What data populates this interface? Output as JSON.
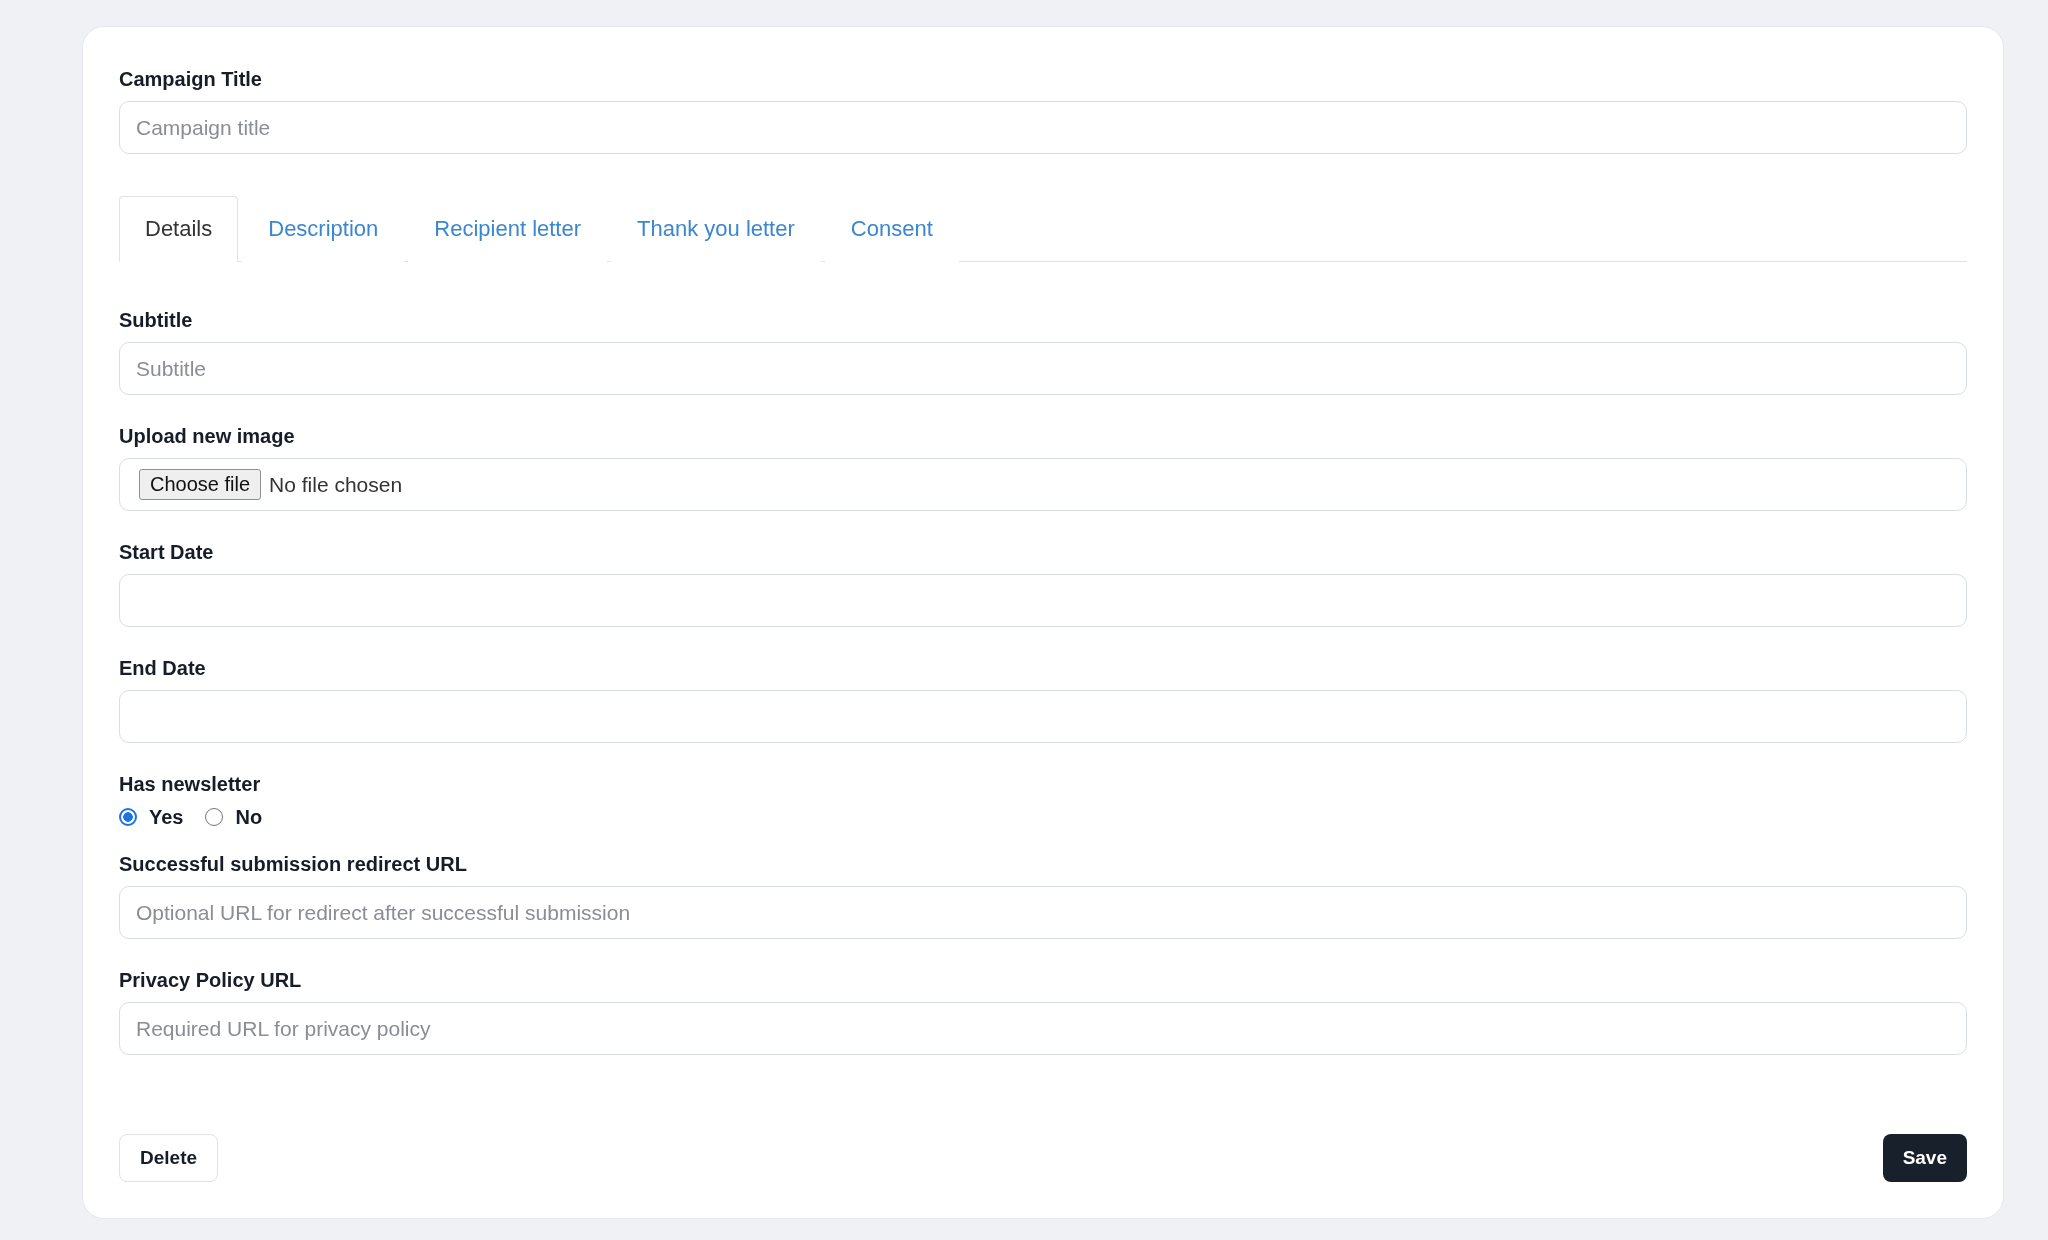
{
  "title_field": {
    "label": "Campaign Title",
    "placeholder": "Campaign title"
  },
  "tabs": [
    {
      "label": "Details",
      "selected": true
    },
    {
      "label": "Description",
      "selected": false
    },
    {
      "label": "Recipient letter",
      "selected": false
    },
    {
      "label": "Thank you letter",
      "selected": false
    },
    {
      "label": "Consent",
      "selected": false
    }
  ],
  "fields": [
    {
      "kind": "text",
      "label": "Subtitle",
      "placeholder": "Subtitle"
    },
    {
      "kind": "file",
      "label": "Upload new image",
      "button": "Choose file",
      "status": "No file chosen"
    },
    {
      "kind": "date",
      "label": "Start Date"
    },
    {
      "kind": "date",
      "label": "End Date"
    },
    {
      "kind": "radio",
      "label": "Has newsletter",
      "options": [
        {
          "label": "Yes",
          "selected": true
        },
        {
          "label": "No",
          "selected": false
        }
      ]
    },
    {
      "kind": "text",
      "label": "Successful submission redirect URL",
      "placeholder": "Optional URL for redirect after successful submission"
    },
    {
      "kind": "text",
      "label": "Privacy Policy URL",
      "placeholder": "Required URL for privacy policy"
    }
  ],
  "actions": {
    "delete": "Delete",
    "save": "Save"
  }
}
